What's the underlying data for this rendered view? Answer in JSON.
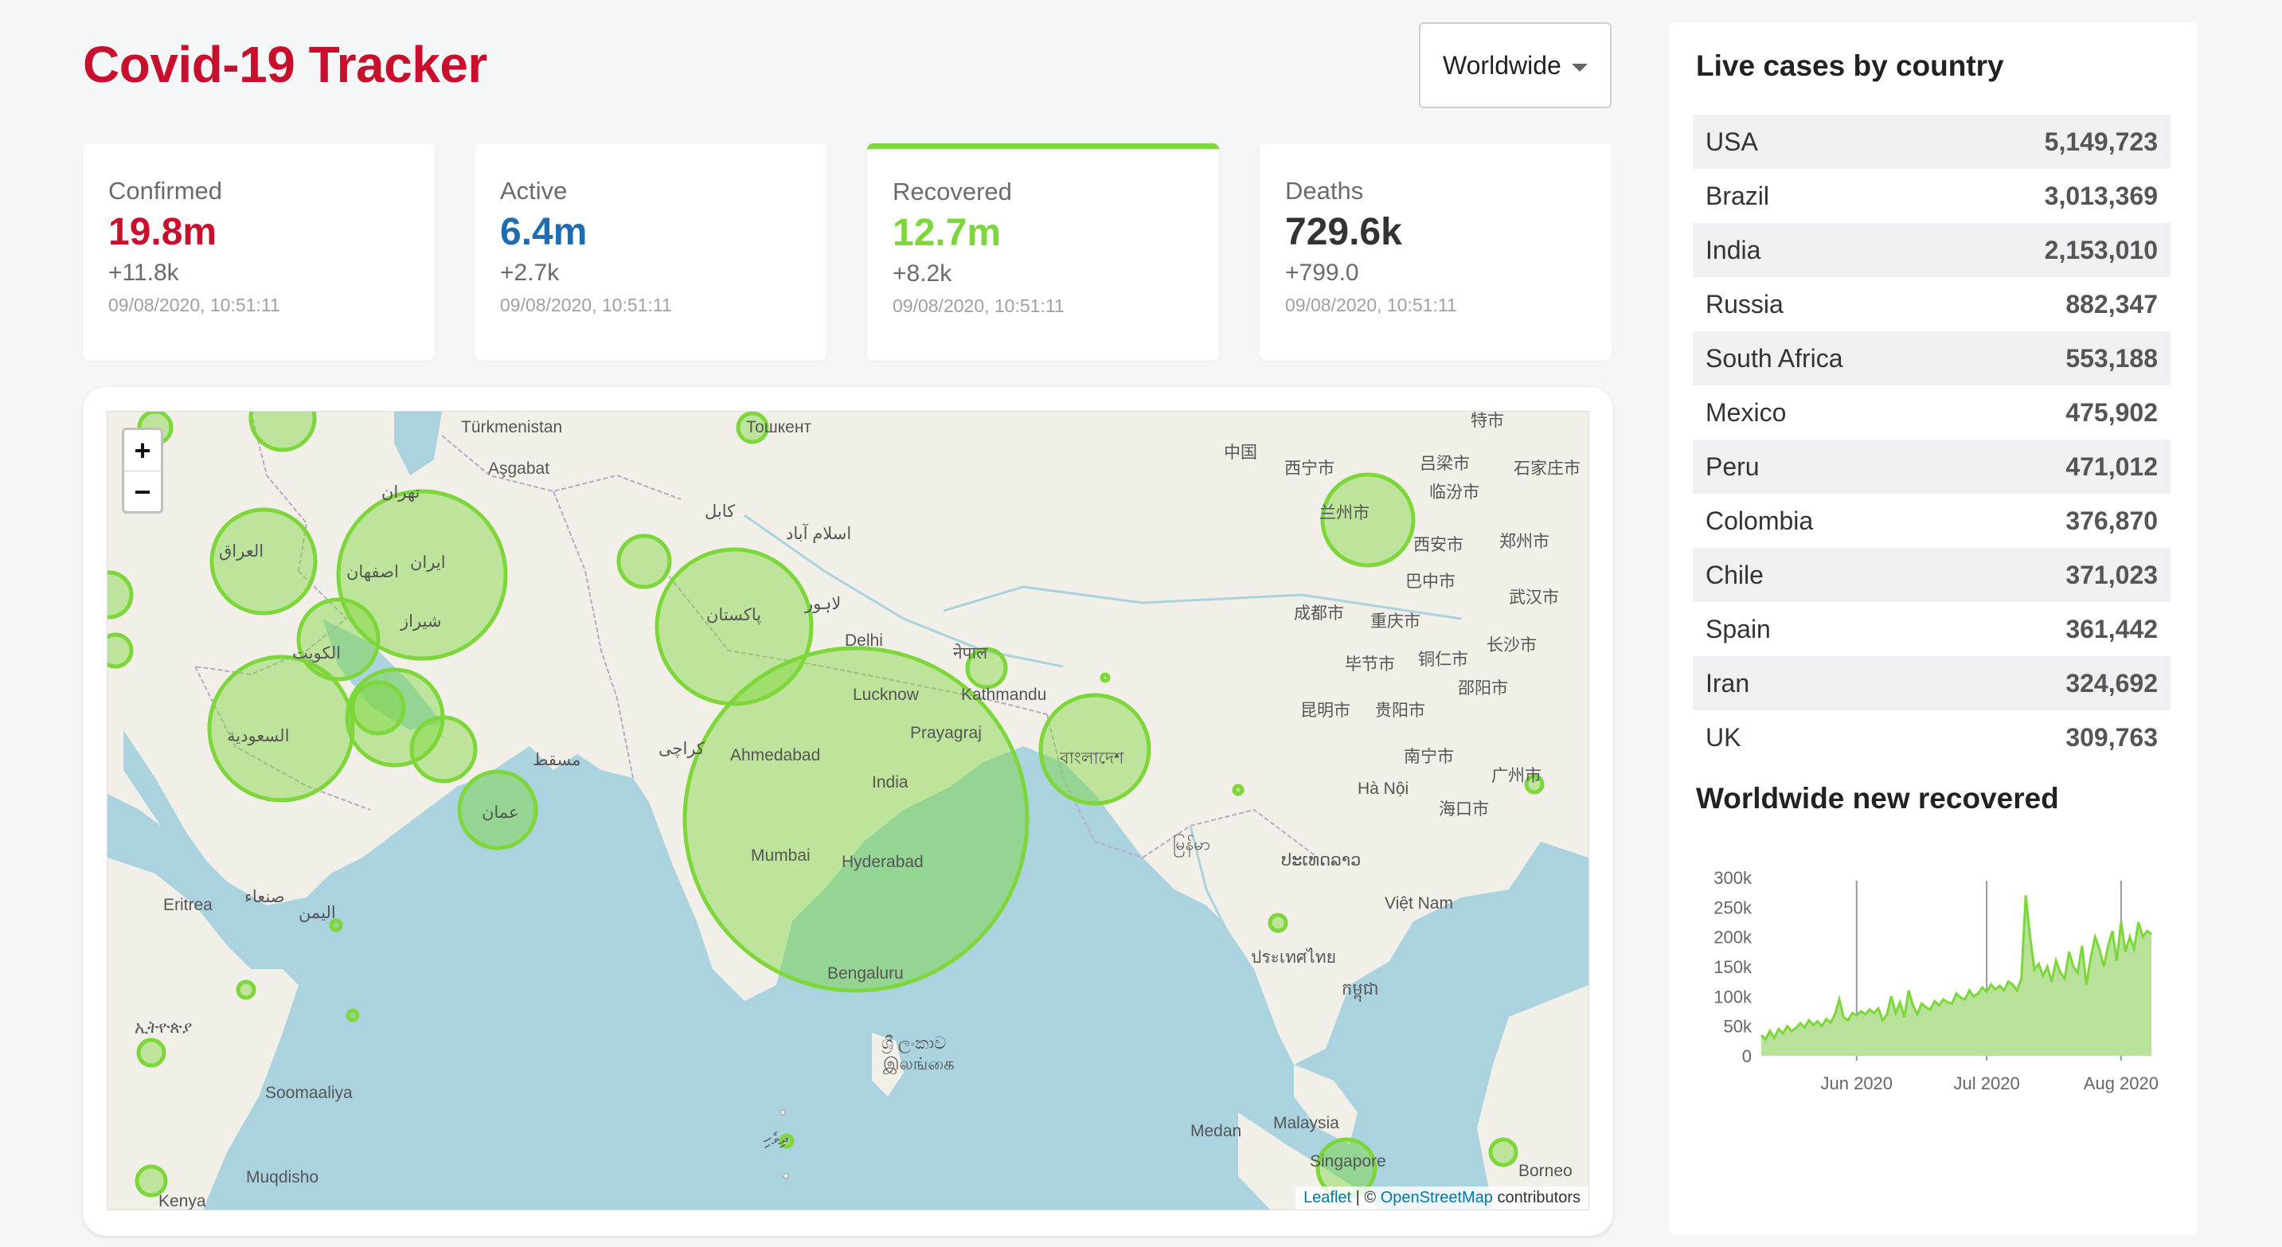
{
  "app": {
    "title": "Covid-19 Tracker"
  },
  "country_select": {
    "selected": "Worldwide"
  },
  "stats": [
    {
      "label": "Confirmed",
      "total": "19.8m",
      "change": "+11.8k",
      "updated": "09/08/2020, 10:51:11",
      "color": "#c8102e"
    },
    {
      "label": "Active",
      "total": "6.4m",
      "change": "+2.7k",
      "updated": "09/08/2020, 10:51:11",
      "color": "#1f6cb0"
    },
    {
      "label": "Recovered",
      "total": "12.7m",
      "change": "+8.2k",
      "updated": "09/08/2020, 10:51:11",
      "color": "#7dd63a"
    },
    {
      "label": "Deaths",
      "total": "729.6k",
      "change": "+799.0",
      "updated": "09/08/2020, 10:51:11",
      "color": "#333333"
    }
  ],
  "map": {
    "zoom_in": "+",
    "zoom_out": "−",
    "attribution": {
      "leaflet": "Leaflet",
      "separator": " | © ",
      "osm": "OpenStreetMap",
      "suffix": " contributors"
    },
    "labels": {
      "turkmenistan": "Türkmenistan",
      "asgabat": "Aşgabat",
      "delhi": "Delhi",
      "lucknow": "Lucknow",
      "kathmandu": "Kathmandu",
      "prayagraj": "Prayagraj",
      "ahmedabad": "Ahmedabad",
      "india": "India",
      "mumbai": "Mumbai",
      "hyderabad": "Hyderabad",
      "bengaluru": "Bengaluru",
      "eritrea": "Eritrea",
      "somaaliya": "Soomaaliya",
      "muqdisho": "Muqdisho",
      "kenya": "Kenya",
      "medan": "Medan",
      "malaysia": "Malaysia",
      "singapore": "Singapore",
      "borneo": "Borneo",
      "vietnam": "Việt Nam",
      "hanoi": "Hà Nội",
      "china": "中国",
      "xining": "西宁市",
      "lanzhou": "兰州市",
      "xian": "西安市",
      "chengdu": "成都市",
      "chongqing": "重庆市",
      "bazhong": "巴中市",
      "wuhan": "武汉市",
      "changsha": "长沙市",
      "guiyang": "贵阳市",
      "kunming": "昆明市",
      "nanning": "南宁市",
      "guangzhou": "广州市",
      "haikou": "海口市",
      "zhengzhou": "郑州市",
      "linfen": "临汾市",
      "lvliang": "吕梁市",
      "shijiazhuang": "石家庄市",
      "tianjin": "特市",
      "bijie": "毕节市",
      "tongren": "铜仁市",
      "shaoyang": "邵阳市",
      "iraq": "العراق",
      "iran": "ایران",
      "saudi": "السعودية",
      "pakistan": "پاکستان",
      "oman": "عمان",
      "muscat": "مسقط",
      "bangladesh": "বাংলাদেশ",
      "srilanka": "ශ්‍රී ලංකාව",
      "lanka_ta": "இலங்கை",
      "tehran": "تهران",
      "isfahan": "اصفهان",
      "shiraz": "شیراز",
      "kabul": "کابل",
      "islamabad": "اسلام آباد",
      "lahore": "لاہور",
      "karachi": "کراچی",
      "yemen": "اليمن",
      "sanaa": "صنعاء",
      "kuwait": "الكويت",
      "myanmar": "မြန်မာ",
      "thailand": "ประเทศไทย",
      "laos": "ປະເທດລາວ",
      "cambodia": "កម្ពុជា",
      "maldives": "ދިވެހި",
      "nepal": "नेपाल",
      "ethiopia": "ኢትዮጵያ",
      "tashkent": "Тошкент"
    }
  },
  "live_cases": {
    "title": "Live cases by country",
    "rows": [
      {
        "country": "USA",
        "cases": "5,149,723"
      },
      {
        "country": "Brazil",
        "cases": "3,013,369"
      },
      {
        "country": "India",
        "cases": "2,153,010"
      },
      {
        "country": "Russia",
        "cases": "882,347"
      },
      {
        "country": "South Africa",
        "cases": "553,188"
      },
      {
        "country": "Mexico",
        "cases": "475,902"
      },
      {
        "country": "Peru",
        "cases": "471,012"
      },
      {
        "country": "Colombia",
        "cases": "376,870"
      },
      {
        "country": "Chile",
        "cases": "371,023"
      },
      {
        "country": "Spain",
        "cases": "361,442"
      },
      {
        "country": "Iran",
        "cases": "324,692"
      },
      {
        "country": "UK",
        "cases": "309,763"
      }
    ]
  },
  "chart": {
    "title": "Worldwide new recovered",
    "colors": {
      "line": "#7dd63a",
      "fill": "#b8e29a"
    }
  },
  "chart_data": {
    "type": "area",
    "title": "Worldwide new recovered",
    "xlabel": "",
    "ylabel": "",
    "ylim": [
      0,
      300000
    ],
    "yticks": [
      "0",
      "50k",
      "100k",
      "150k",
      "200k",
      "250k",
      "300k"
    ],
    "xticks": [
      "Jun 2020",
      "Jul 2020",
      "Aug 2020"
    ],
    "x_start": "2020-05-10",
    "x_end": "2020-08-08",
    "values": [
      35000,
      28000,
      42000,
      30000,
      45000,
      38000,
      50000,
      42000,
      47000,
      55000,
      48000,
      60000,
      52000,
      58000,
      50000,
      62000,
      56000,
      70000,
      95000,
      65000,
      60000,
      72000,
      68000,
      75000,
      70000,
      78000,
      72000,
      80000,
      60000,
      70000,
      100000,
      72000,
      90000,
      65000,
      110000,
      85000,
      70000,
      88000,
      82000,
      78000,
      92000,
      85000,
      95000,
      90000,
      88000,
      105000,
      98000,
      95000,
      110000,
      100000,
      105000,
      115000,
      108000,
      120000,
      112000,
      118000,
      110000,
      125000,
      120000,
      110000,
      130000,
      270000,
      200000,
      145000,
      155000,
      135000,
      150000,
      125000,
      160000,
      140000,
      130000,
      175000,
      150000,
      140000,
      185000,
      120000,
      165000,
      200000,
      180000,
      150000,
      185000,
      210000,
      160000,
      225000,
      175000,
      200000,
      180000,
      225000,
      200000,
      210000,
      205000
    ]
  }
}
